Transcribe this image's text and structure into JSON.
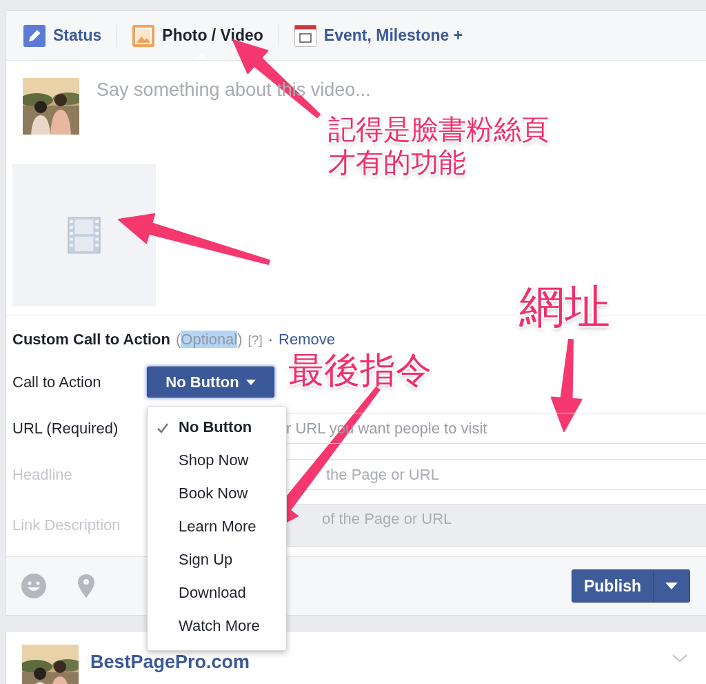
{
  "tabs": [
    {
      "label": "Status",
      "selected": false
    },
    {
      "label": "Photo / Video",
      "selected": true
    },
    {
      "label": "Event, Milestone +",
      "selected": false
    }
  ],
  "composer": {
    "placeholder": "Say something about this video..."
  },
  "call_to_action": {
    "title": "Custom Call to Action",
    "optional": [
      "(",
      "Optional",
      ")"
    ],
    "help": "[?]",
    "separator": "·",
    "remove": "Remove",
    "fields": [
      {
        "label": "Call to Action",
        "kind": "select",
        "value": "No Button",
        "disabled": false
      },
      {
        "label": "URL (Required)",
        "kind": "text",
        "placeholder": "r URL you want people to visit",
        "disabled": false
      },
      {
        "label": "Headline",
        "kind": "text",
        "placeholder": "the Page or URL",
        "disabled": true
      },
      {
        "label": "Link Description",
        "kind": "textarea",
        "placeholder": "of the Page or URL",
        "disabled": true
      }
    ]
  },
  "menu": {
    "open": true,
    "items": [
      {
        "label": "No Button",
        "selected": true
      },
      {
        "label": "Shop Now",
        "selected": false
      },
      {
        "label": "Book Now",
        "selected": false
      },
      {
        "label": "Learn More",
        "selected": false
      },
      {
        "label": "Sign Up",
        "selected": false
      },
      {
        "label": "Download",
        "selected": false
      },
      {
        "label": "Watch More",
        "selected": false
      }
    ]
  },
  "footer": {
    "publish": "Publish"
  },
  "feed_post": {
    "name": "BestPagePro.com"
  },
  "annotations": [
    {
      "lines": [
        "記得是臉書粉絲頁",
        "才有的功能"
      ]
    },
    {
      "lines": [
        "網址"
      ]
    },
    {
      "lines": [
        "最後指令"
      ]
    }
  ]
}
